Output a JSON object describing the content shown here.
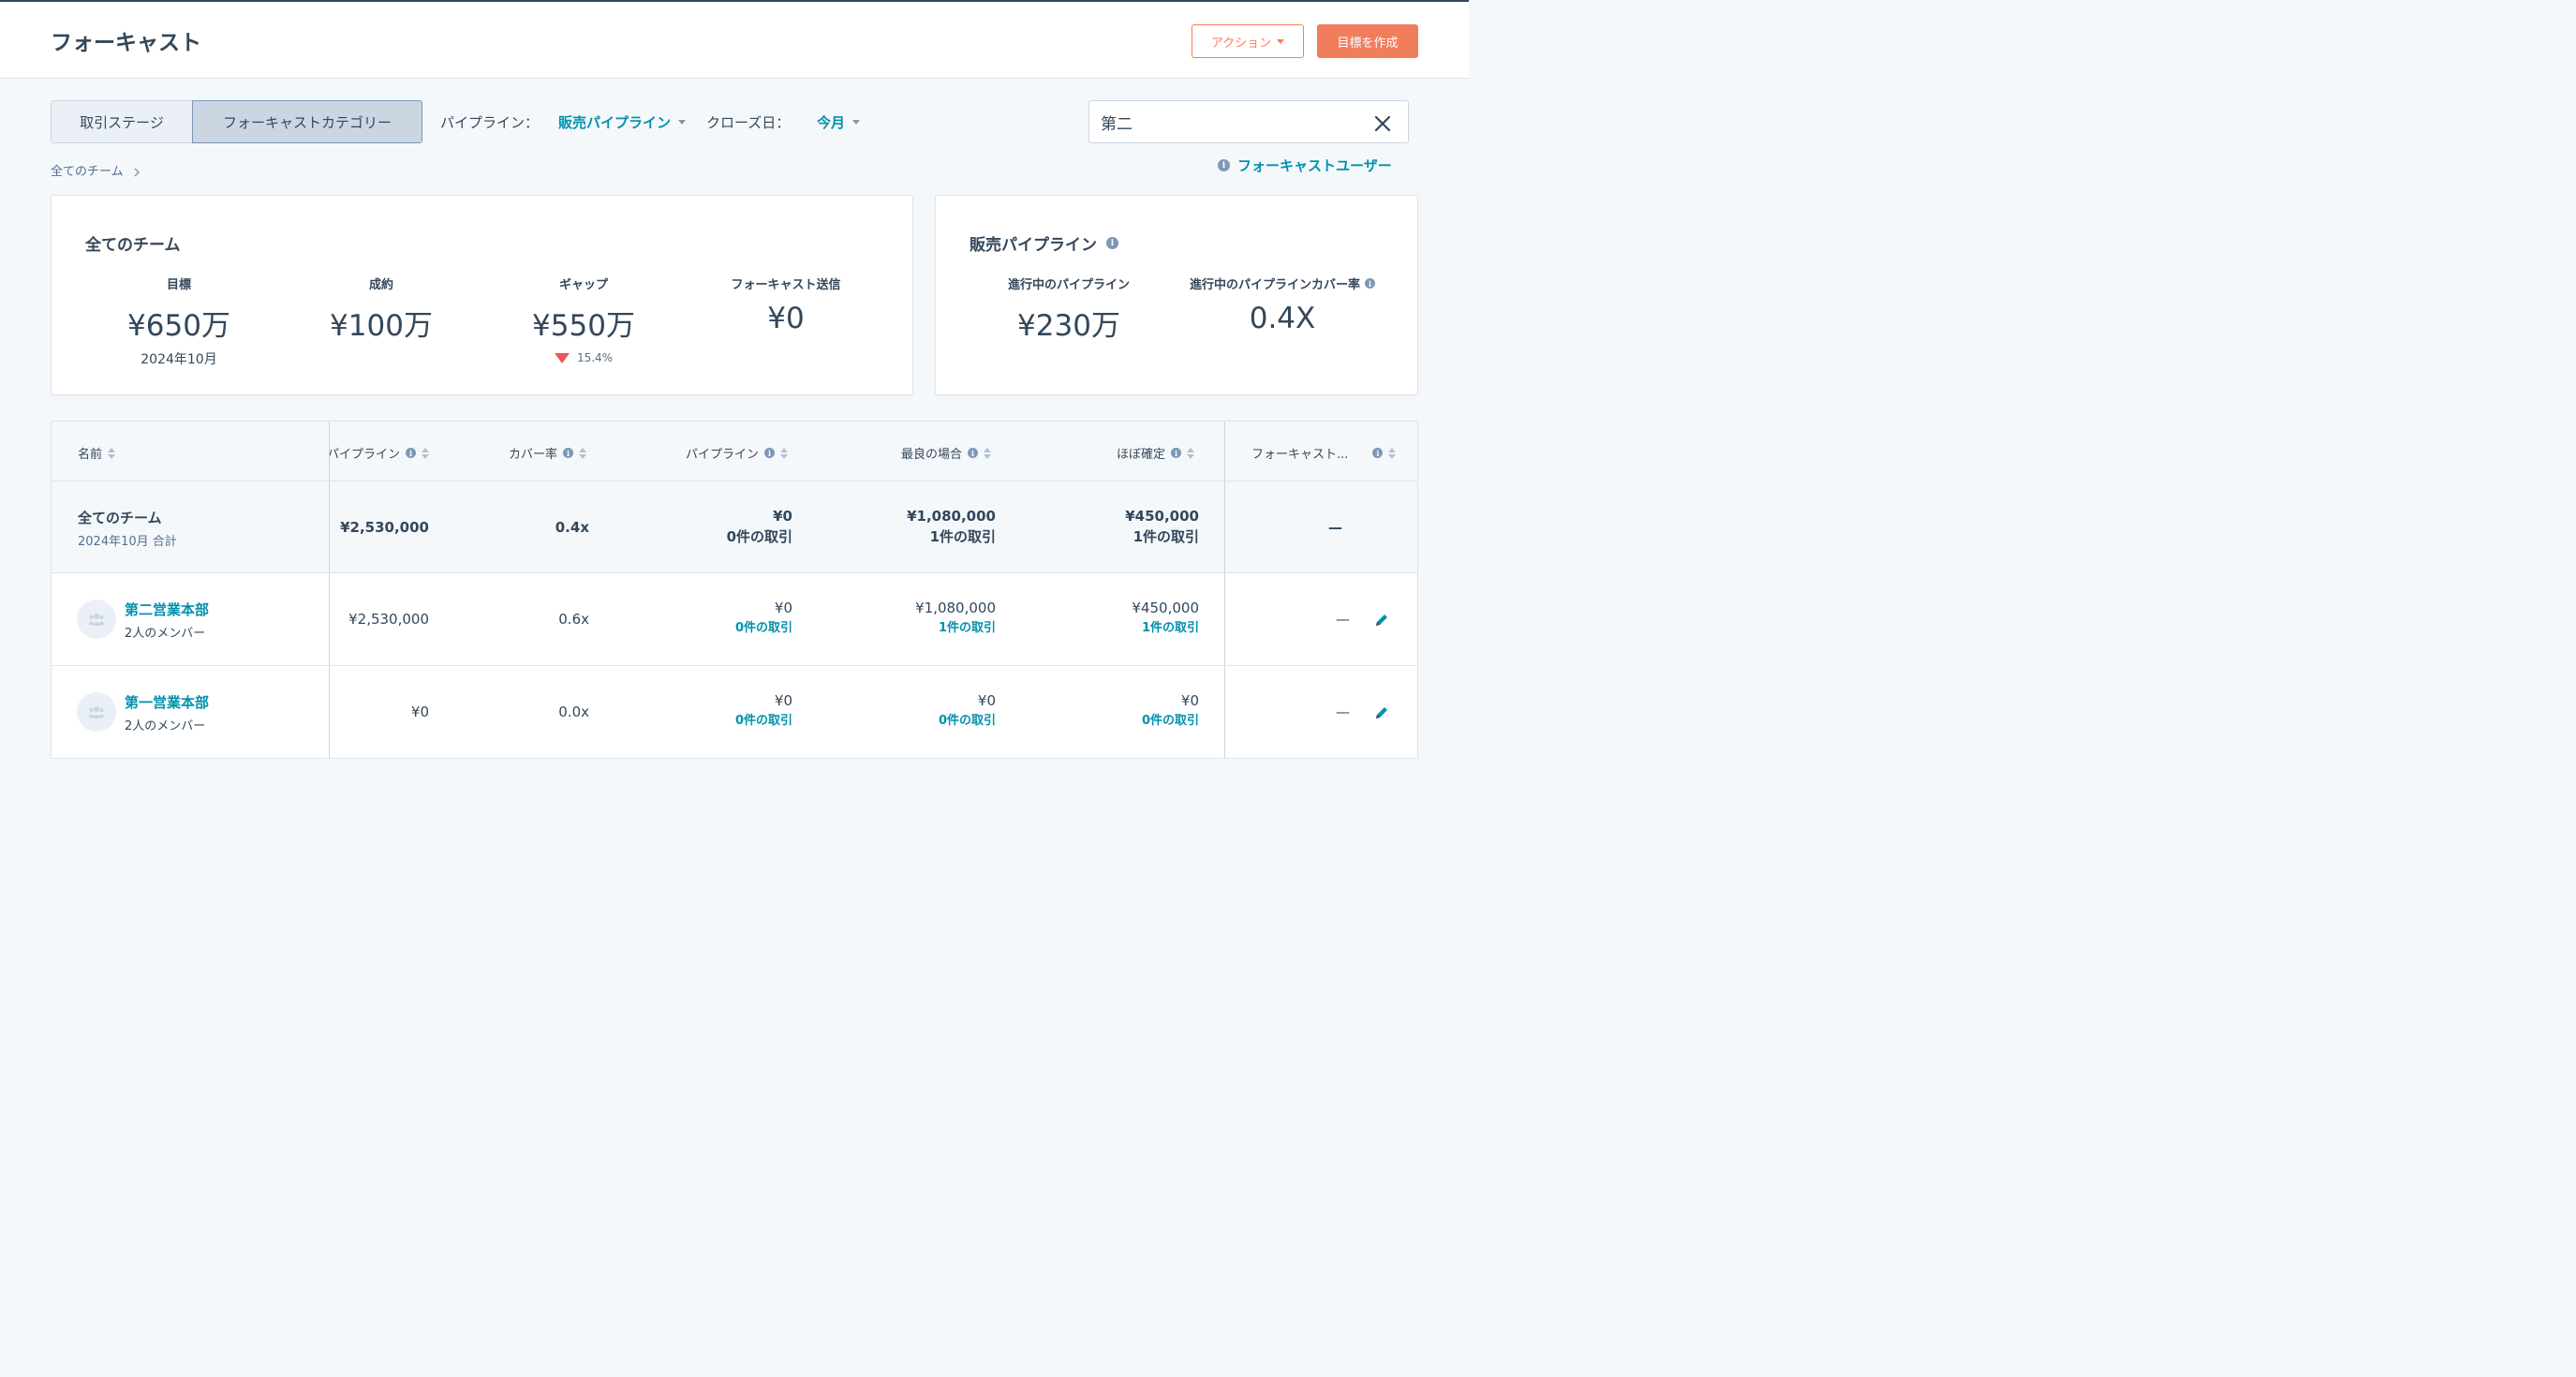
{
  "header": {
    "title": "フォーキャスト",
    "action_label": "アクション",
    "create_goal_label": "目標を作成"
  },
  "toolbar": {
    "segments": [
      "取引ステージ",
      "フォーキャストカテゴリー"
    ],
    "pipeline_label": "パイプライン：",
    "pipeline_value": "販売パイプライン",
    "close_date_label": "クローズ日：",
    "close_date_value": "今月",
    "search_value": "第二"
  },
  "breadcrumb": "全てのチーム",
  "forecast_users_link": "フォーキャストユーザー",
  "summary_card": {
    "title": "全てのチーム",
    "kpis": [
      {
        "label": "目標",
        "value": "¥650万",
        "sub": "2024年10月"
      },
      {
        "label": "成約",
        "value": "¥100万"
      },
      {
        "label": "ギャップ",
        "value": "¥550万",
        "trend": "15.4%"
      },
      {
        "label": "フォーキャスト送信",
        "value": "¥0"
      }
    ]
  },
  "pipeline_card": {
    "title": "販売パイプライン",
    "kpis": [
      {
        "label": "進行中のパイプライン",
        "value": "¥230万"
      },
      {
        "label": "進行中のパイプラインカバー率",
        "value": "0.4X"
      }
    ]
  },
  "table": {
    "columns": [
      "名前",
      "パイプライン",
      "カバー率",
      "パイプライン",
      "最良の場合",
      "ほぼ確定",
      "フォーキャスト..."
    ],
    "total_row": {
      "name": "全てのチーム",
      "sub": "2024年10月 合計",
      "pipeline": "¥2,530,000",
      "coverage": "0.4x",
      "pipeline2": "¥0",
      "pipeline2_deals": "0件の取引",
      "best_case": "¥1,080,000",
      "best_case_deals": "1件の取引",
      "commit": "¥450,000",
      "commit_deals": "1件の取引",
      "forecast": "—"
    },
    "rows": [
      {
        "name": "第二営業本部",
        "sub": "2人のメンバー",
        "pipeline": "¥2,530,000",
        "coverage": "0.6x",
        "pipeline2": "¥0",
        "pipeline2_deals": "0件の取引",
        "best_case": "¥1,080,000",
        "best_case_deals": "1件の取引",
        "commit": "¥450,000",
        "commit_deals": "1件の取引",
        "forecast": "—"
      },
      {
        "name": "第一営業本部",
        "sub": "2人のメンバー",
        "pipeline": "¥0",
        "coverage": "0.0x",
        "pipeline2": "¥0",
        "pipeline2_deals": "0件の取引",
        "best_case": "¥0",
        "best_case_deals": "0件の取引",
        "commit": "¥0",
        "commit_deals": "0件の取引",
        "forecast": "—"
      }
    ]
  },
  "colors": {
    "accent": "#ff7a59",
    "link": "#0091ae",
    "text": "#33475b",
    "negative": "#f2545b"
  },
  "icons": [
    "caret-down-icon",
    "close-icon",
    "info-icon",
    "chevron-right-icon",
    "sort-icon",
    "team-avatar-icon",
    "pencil-icon",
    "trend-down-icon"
  ]
}
